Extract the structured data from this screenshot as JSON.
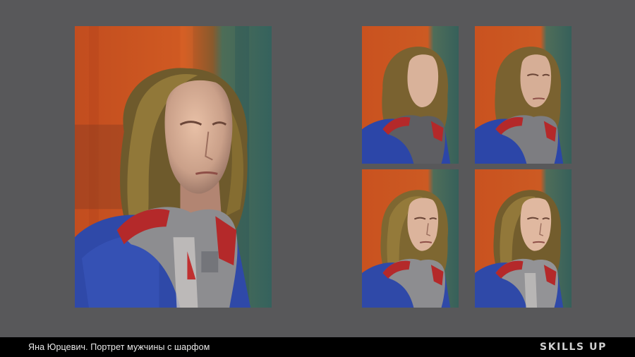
{
  "caption": "Яна Юрцевич. Портрет мужчины с шарфом",
  "brand": "SKILLS UP",
  "colors": {
    "background": "#58585a",
    "footer": "#000000",
    "drape_orange": "#c4541f",
    "drape_green": "#3f6b5c",
    "coat_blue": "#2e4aa6",
    "scarf_red": "#b52a2a",
    "hair": "#7b6431"
  },
  "artworks": [
    {
      "stage": "final"
    },
    {
      "stage": "blocking, faceless"
    },
    {
      "stage": "refined"
    },
    {
      "stage": "detailed"
    },
    {
      "stage": "final"
    }
  ]
}
